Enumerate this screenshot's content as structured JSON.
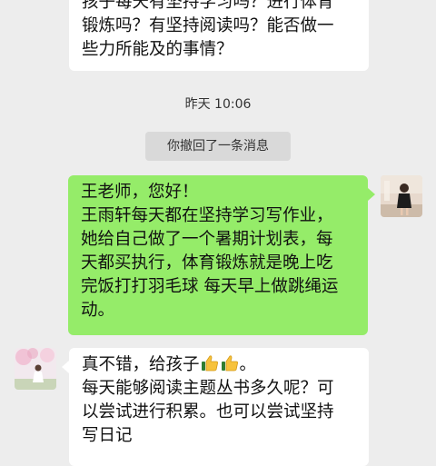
{
  "messages": [
    {
      "direction": "incoming",
      "lines": [
        "孩子每天有坚持学习吗？进行体育",
        "锻炼吗？有坚持阅读吗？能否做一",
        "些力所能及的事情？"
      ]
    },
    {
      "direction": "outgoing",
      "lines": [
        "王老师，您好！",
        "王雨轩每天都在坚持学习写作业，",
        "她给自己做了一个暑期计划表，每",
        "天都买执行，体育锻炼就是晚上吃",
        "完饭打打羽毛球 每天早上做跳绳运",
        "动。"
      ]
    },
    {
      "direction": "incoming",
      "first_line_text": "真不错，给孩子",
      "first_line_end": "。",
      "lines": [
        "每天能够阅读主题丛书多久呢？可",
        "以尝试进行积累。也可以尝试坚持",
        "写日记"
      ]
    }
  ],
  "timestamp": "昨天 10:06",
  "system_message": "你撤回了一条消息",
  "emoji": [
    "thumbs-up",
    "thumbs-up"
  ],
  "colors": {
    "background": "#ededed",
    "incoming_bubble": "#ffffff",
    "outgoing_bubble": "#95ec69",
    "system_pill": "#d9d9d9"
  }
}
